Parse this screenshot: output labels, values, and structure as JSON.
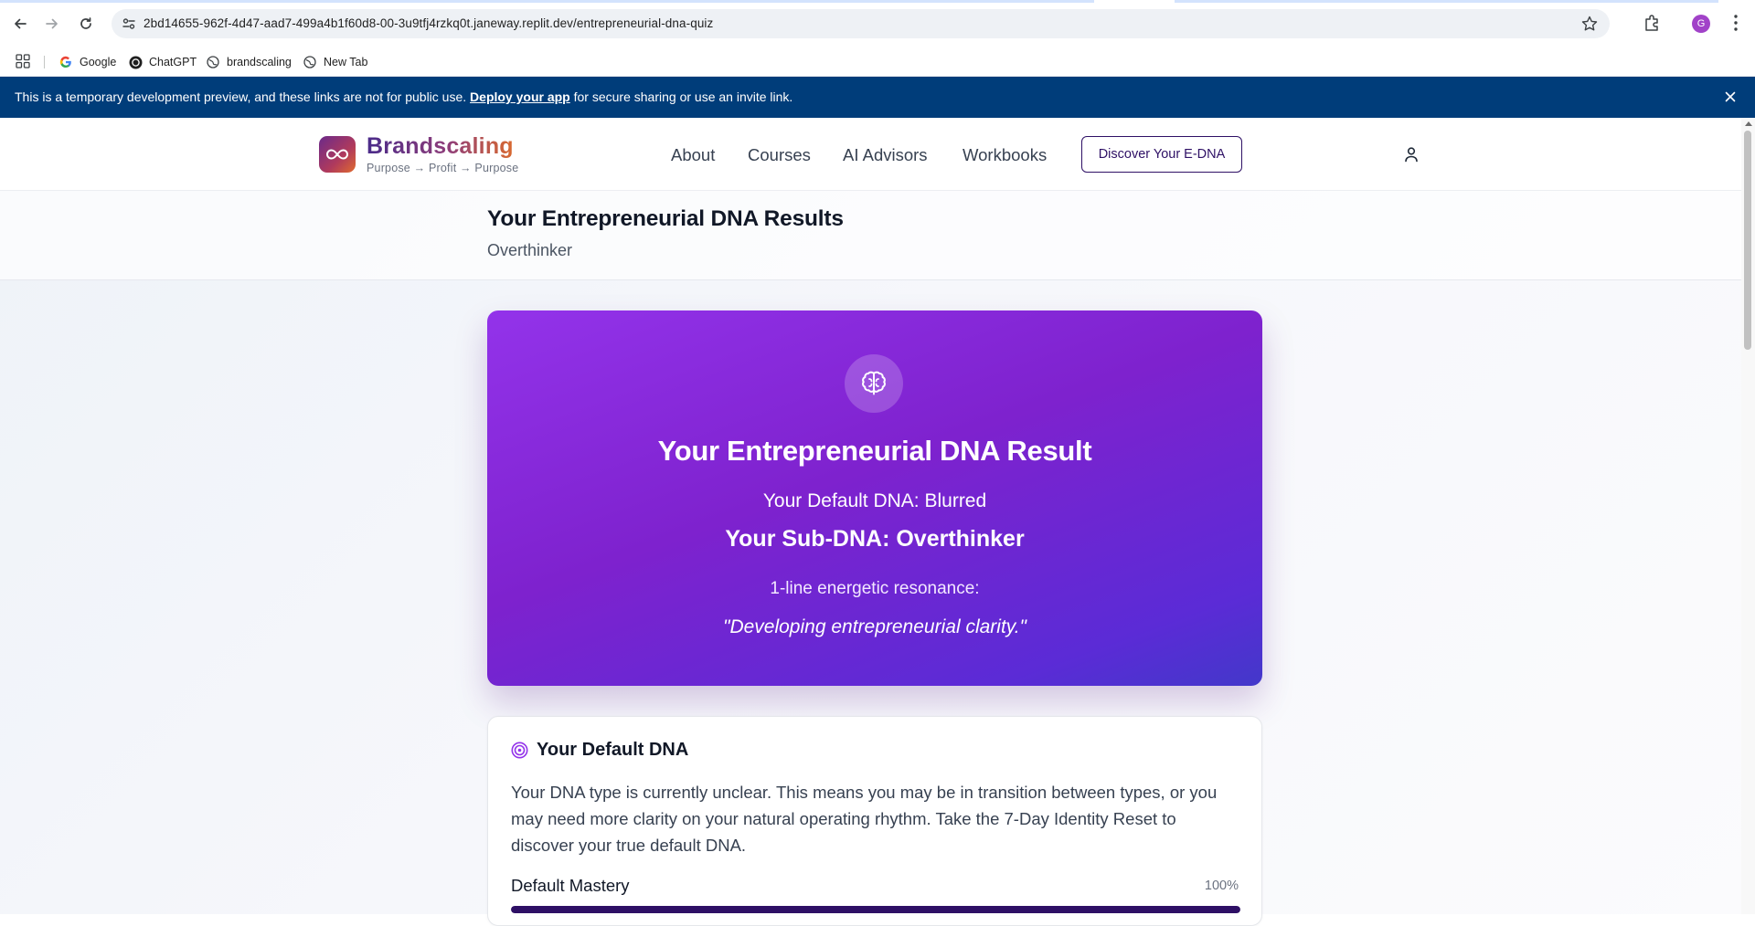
{
  "browser": {
    "url": "2bd14655-962f-4d47-aad7-499a4b1f60d8-00-3u9tfj4rzkq0t.janeway.replit.dev/entrepreneurial-dna-quiz",
    "profile_initial": "G",
    "bookmarks": [
      "Google",
      "ChatGPT",
      "brandscaling",
      "New Tab"
    ]
  },
  "banner": {
    "text_before": "This is a temporary development preview, and these links are not for public use.",
    "link": "Deploy your app",
    "text_after": "for secure sharing or use an invite link."
  },
  "header": {
    "brand": "Brandscaling",
    "tagline": "Purpose → Profit → Purpose",
    "nav": [
      "About",
      "Courses",
      "AI Advisors",
      "Workbooks"
    ],
    "cta": "Discover Your E-DNA"
  },
  "results": {
    "title": "Your Entrepreneurial DNA Results",
    "subtitle": "Overthinker"
  },
  "result_card": {
    "icon": "brain-icon",
    "heading": "Your Entrepreneurial DNA Result",
    "default_dna": "Your Default DNA: Blurred",
    "sub_dna": "Your Sub-DNA: Overthinker",
    "resonance_label": "1-line energetic resonance:",
    "quote": "\"Developing entrepreneurial clarity.\""
  },
  "default_dna_card": {
    "icon": "target-icon",
    "title": "Your Default DNA",
    "body": "Your DNA type is currently unclear. This means you may be in transition between types, or you may need more clarity on your natural operating rhythm. Take the 7-Day Identity Reset to discover your true default DNA.",
    "mastery_label": "Default Mastery",
    "mastery_value": "100%",
    "mastery_fraction": 1.0
  },
  "colors": {
    "banner": "#003d7a",
    "card_start": "#9333ea",
    "card_end": "#4338ca",
    "progress_fill": "#2e1065"
  }
}
